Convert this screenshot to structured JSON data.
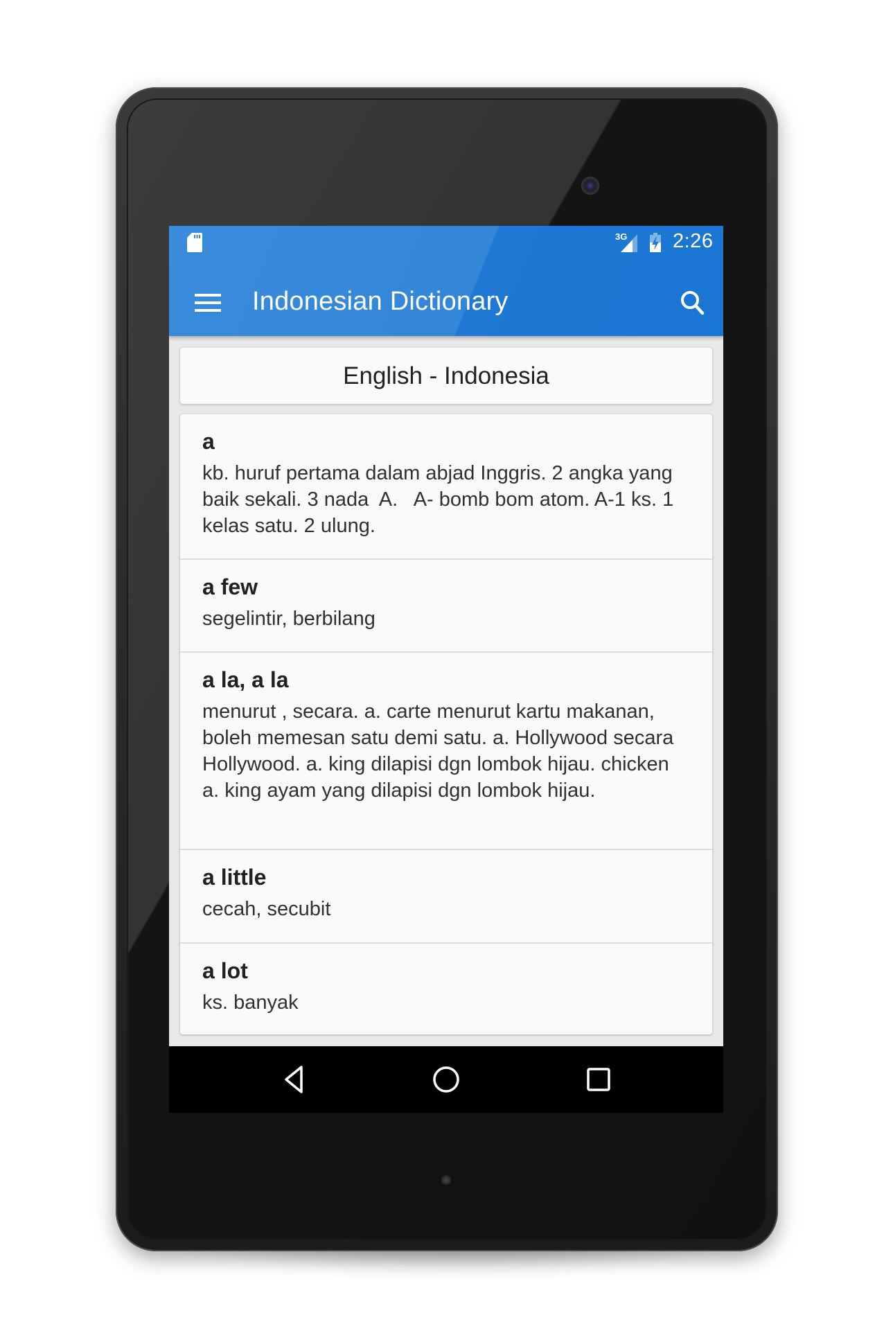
{
  "status_bar": {
    "network_type": "3G",
    "time": "2:26",
    "icons": [
      "sd-card-icon",
      "signal-icon",
      "battery-charging-icon"
    ]
  },
  "toolbar": {
    "title": "Indonesian Dictionary",
    "menu_icon": "hamburger-menu-icon",
    "search_icon": "search-icon"
  },
  "language_selector": {
    "label": "English - Indonesia"
  },
  "entries": [
    {
      "word": "a",
      "definition": "kb. huruf pertama dalam abjad Inggris. 2 angka yang baik sekali. 3 nada  A.   A- bomb bom atom. A-1 ks. 1 kelas satu. 2 ulung."
    },
    {
      "word": "a few",
      "definition": "segelintir, berbilang"
    },
    {
      "word": "a la, a la",
      "definition": "menurut , secara. a. carte menurut kartu makanan, boleh memesan satu demi satu. a. Hollywood secara Hollywood. a. king dilapisi dgn lombok hijau. chicken a. king ayam yang dilapisi dgn lombok hijau."
    },
    {
      "word": "a little",
      "definition": "cecah, secubit"
    },
    {
      "word": "a lot",
      "definition": "ks. banyak"
    }
  ],
  "nav_bar": {
    "buttons": [
      "back-icon",
      "home-icon",
      "recents-icon"
    ]
  },
  "colors": {
    "primary": "#1976d2",
    "background": "#e8e8e8",
    "card": "#fafafa",
    "text": "#212121"
  }
}
